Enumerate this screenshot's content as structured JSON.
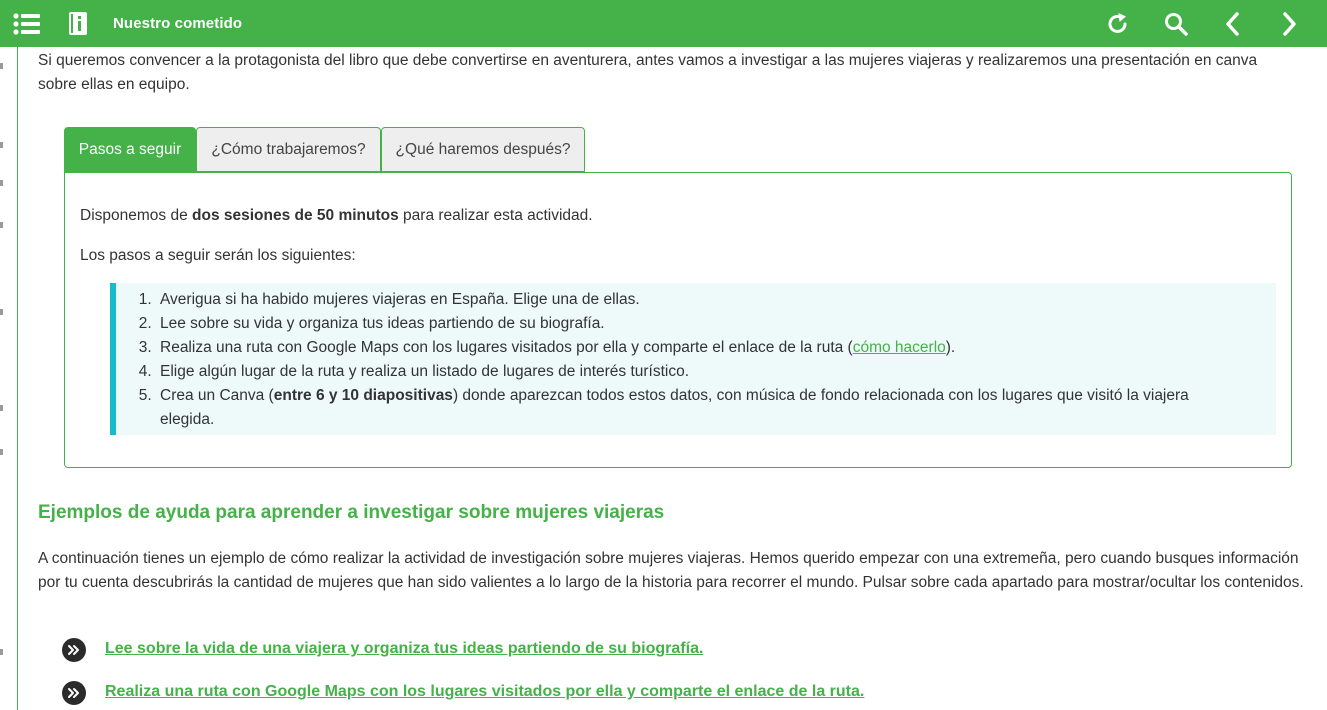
{
  "header": {
    "title": "Nuestro cometido",
    "icons": [
      "menu-icon",
      "book-info-icon",
      "reload-icon",
      "search-icon",
      "chevron-left-icon",
      "chevron-right-icon"
    ],
    "background_color": "#45b149"
  },
  "intro_paragraph": "Si queremos convencer a la protagonista del libro que debe convertirse en aventurera, antes vamos a investigar a las mujeres viajeras y realizaremos una presentación en canva sobre ellas en equipo.",
  "tabs": [
    {
      "label": "Pasos a seguir",
      "active": true
    },
    {
      "label": "¿Cómo trabajaremos?",
      "active": false
    },
    {
      "label": "¿Qué haremos después?",
      "active": false
    }
  ],
  "panel": {
    "line1_before": "Disponemos de ",
    "line1_bold": "dos sesiones de 50 minutos",
    "line1_after": " para realizar esta actividad.",
    "line2": "Los pasos a seguir serán los siguientes:",
    "steps": [
      {
        "text": "Averigua si ha habido mujeres viajeras en España. Elige una de ellas."
      },
      {
        "text": "Lee sobre su vida y organiza tus ideas partiendo de su biografía."
      },
      {
        "before": "Realiza una ruta con Google Maps con los lugares visitados por ella y comparte el enlace de la ruta (",
        "link": "cómo hacerlo",
        "after": ")."
      },
      {
        "text": "Elige algún lugar de la ruta y realiza un listado de lugares de interés turístico."
      },
      {
        "before": "Crea un Canva (",
        "bold": "entre 6 y 10 diapositivas",
        "after": ") donde aparezcan todos estos datos, con música de fondo relacionada con los lugares que visitó la viajera elegida."
      }
    ]
  },
  "section": {
    "heading": "Ejemplos de ayuda para aprender a investigar sobre mujeres viajeras",
    "paragraph": "A continuación tienes un ejemplo de cómo realizar la actividad de investigación sobre mujeres viajeras. Hemos querido empezar con una extremeña, pero cuando busques información por tu cuenta descubrirás la cantidad de mujeres que han sido valientes a lo largo de la historia para recorrer el mundo. Pulsar sobre cada apartado para mostrar/ocultar los contenidos.",
    "toggles": [
      {
        "label": "Lee sobre la vida de una viajera y organiza tus ideas partiendo de su biografía."
      },
      {
        "label": "Realiza una ruta con Google Maps con los lugares visitados por ella y comparte el enlace de la ruta."
      }
    ]
  },
  "colors": {
    "accent": "#45b149",
    "steps_border": "#17bccb",
    "steps_background": "#eef9f9"
  }
}
